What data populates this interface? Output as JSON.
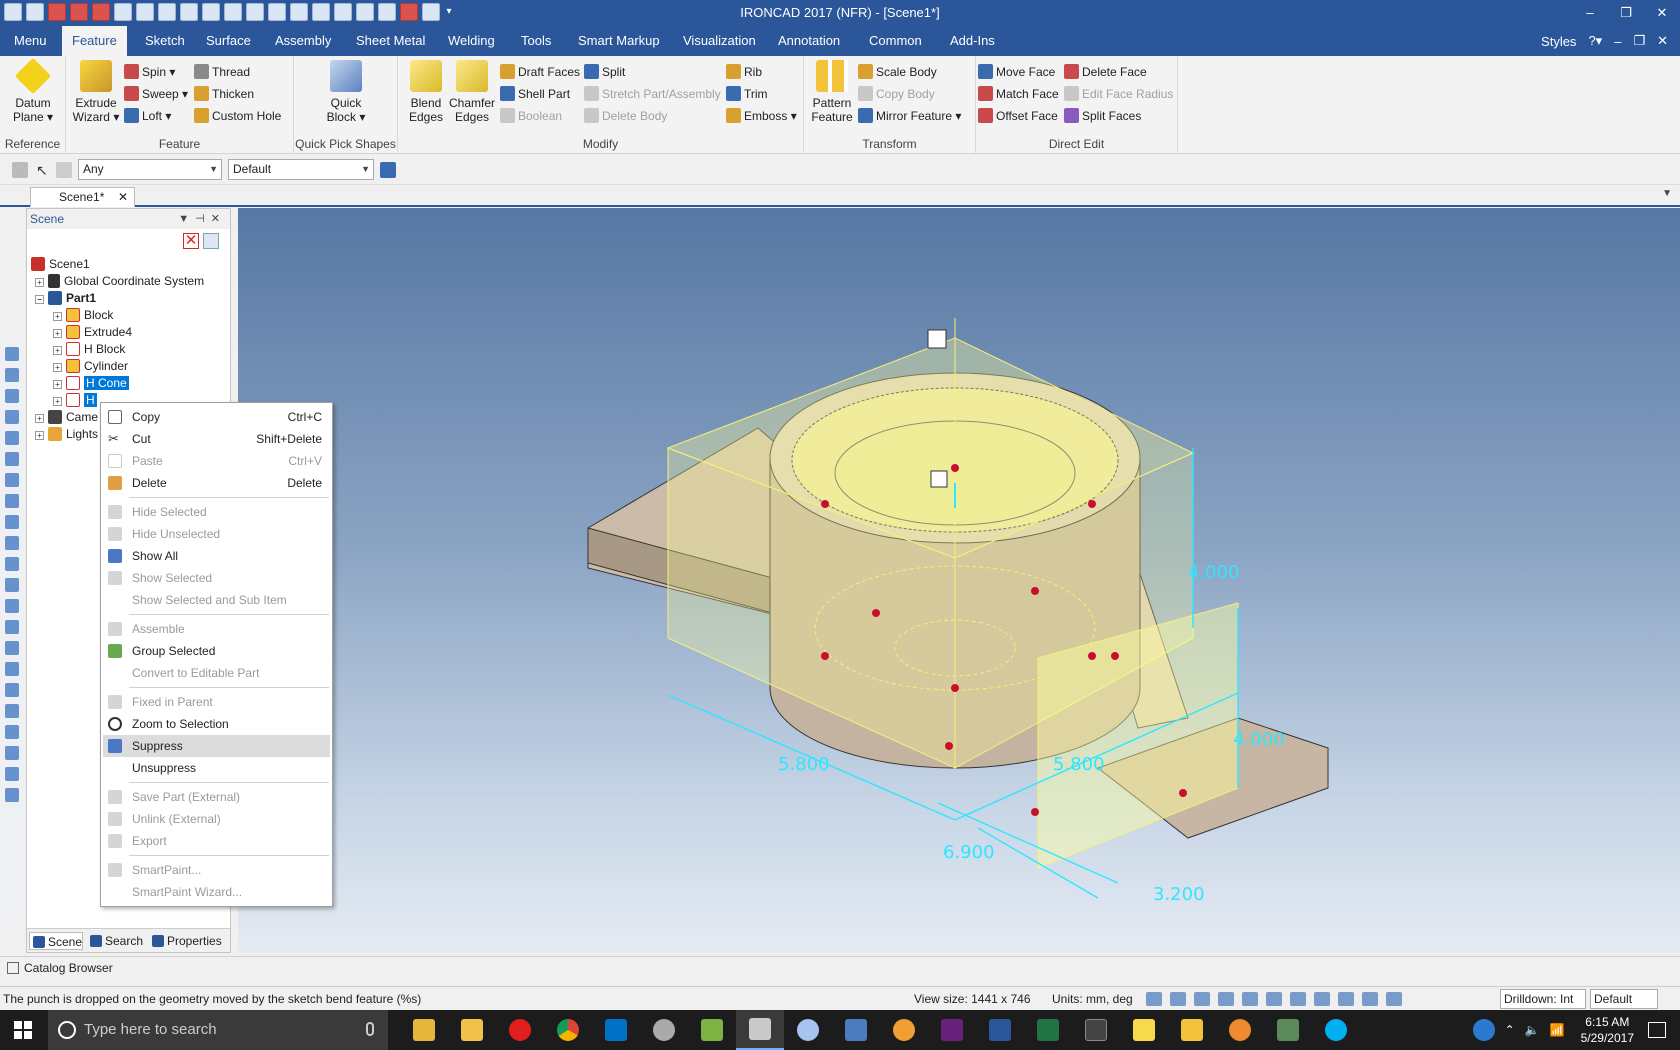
{
  "window": {
    "title": "IRONCAD 2017 (NFR) - [Scene1*]"
  },
  "menubar": {
    "tabs": [
      "Menu",
      "Feature",
      "Sketch",
      "Surface",
      "Assembly",
      "Sheet Metal",
      "Welding",
      "Tools",
      "Smart Markup",
      "Visualization",
      "Annotation",
      "Common",
      "Add-Ins"
    ],
    "styles": "Styles"
  },
  "ribbon": {
    "groups": {
      "reference": "Reference",
      "feature": "Feature",
      "quickpick": "Quick Pick Shapes",
      "modify": "Modify",
      "transform": "Transform",
      "directedit": "Direct Edit"
    },
    "datum_plane": "Datum Plane",
    "extrude_wizard": "Extrude Wizard",
    "spin": "Spin",
    "sweep": "Sweep",
    "loft": "Loft",
    "thread": "Thread",
    "thicken": "Thicken",
    "custom_hole": "Custom Hole",
    "quick_block": "Quick Block",
    "blend_edges": "Blend Edges",
    "chamfer_edges": "Chamfer Edges",
    "draft_faces": "Draft Faces",
    "shell_part": "Shell Part",
    "boolean": "Boolean",
    "split": "Split",
    "stretch": "Stretch Part/Assembly",
    "delete_body": "Delete Body",
    "rib": "Rib",
    "trim": "Trim",
    "emboss": "Emboss",
    "pattern_feature": "Pattern Feature",
    "scale_body": "Scale Body",
    "copy_body": "Copy Body",
    "mirror_feature": "Mirror Feature",
    "move_face": "Move Face",
    "match_face": "Match Face",
    "offset_face": "Offset Face",
    "delete_face": "Delete Face",
    "edit_face_radius": "Edit Face Radius",
    "split_faces": "Split Faces"
  },
  "selection": {
    "filter": "Any",
    "style": "Default"
  },
  "doc_tab": "Scene1*",
  "scene_panel": {
    "title": "Scene",
    "tree": [
      "Scene1",
      "Global Coordinate System",
      "Part1",
      "Block",
      "Extrude4",
      "H Block",
      "Cylinder",
      "H Cone",
      "H",
      "Came",
      "Lights"
    ],
    "footer": [
      "Scene",
      "Search",
      "Properties"
    ]
  },
  "context_menu": [
    {
      "label": "Copy",
      "shortcut": "Ctrl+C",
      "enabled": true
    },
    {
      "label": "Cut",
      "shortcut": "Shift+Delete",
      "enabled": true
    },
    {
      "label": "Paste",
      "shortcut": "Ctrl+V",
      "enabled": false
    },
    {
      "label": "Delete",
      "shortcut": "Delete",
      "enabled": true
    },
    {
      "label": "Hide Selected",
      "shortcut": "",
      "enabled": false
    },
    {
      "label": "Hide Unselected",
      "shortcut": "",
      "enabled": false
    },
    {
      "label": "Show All",
      "shortcut": "",
      "enabled": true
    },
    {
      "label": "Show Selected",
      "shortcut": "",
      "enabled": false
    },
    {
      "label": "Show Selected and Sub Item",
      "shortcut": "",
      "enabled": false
    },
    {
      "label": "Assemble",
      "shortcut": "",
      "enabled": false
    },
    {
      "label": "Group Selected",
      "shortcut": "",
      "enabled": true
    },
    {
      "label": "Convert to Editable Part",
      "shortcut": "",
      "enabled": false
    },
    {
      "label": "Fixed in Parent",
      "shortcut": "",
      "enabled": false
    },
    {
      "label": "Zoom to Selection",
      "shortcut": "",
      "enabled": true
    },
    {
      "label": "Suppress",
      "shortcut": "",
      "enabled": true
    },
    {
      "label": "Unsuppress",
      "shortcut": "",
      "enabled": true
    },
    {
      "label": "Save Part (External)",
      "shortcut": "",
      "enabled": false
    },
    {
      "label": "Unlink (External)",
      "shortcut": "",
      "enabled": false
    },
    {
      "label": "Export",
      "shortcut": "",
      "enabled": false
    },
    {
      "label": "SmartPaint...",
      "shortcut": "",
      "enabled": false
    },
    {
      "label": "SmartPaint Wizard...",
      "shortcut": "",
      "enabled": false
    }
  ],
  "dimensions": [
    "4.000",
    "4.000",
    "5.800",
    "5.800",
    "6.900",
    "3.200"
  ],
  "catalog": "Catalog Browser",
  "status": {
    "message": "The punch is dropped on the geometry moved by the sketch bend feature (%s)",
    "view_size": "View size: 1441 x 746",
    "units": "Units: mm, deg",
    "drilldown": "Drilldown: Int",
    "style": "Default"
  },
  "taskbar": {
    "search_placeholder": "Type here to search",
    "time": "6:15 AM",
    "date": "5/29/2017"
  }
}
